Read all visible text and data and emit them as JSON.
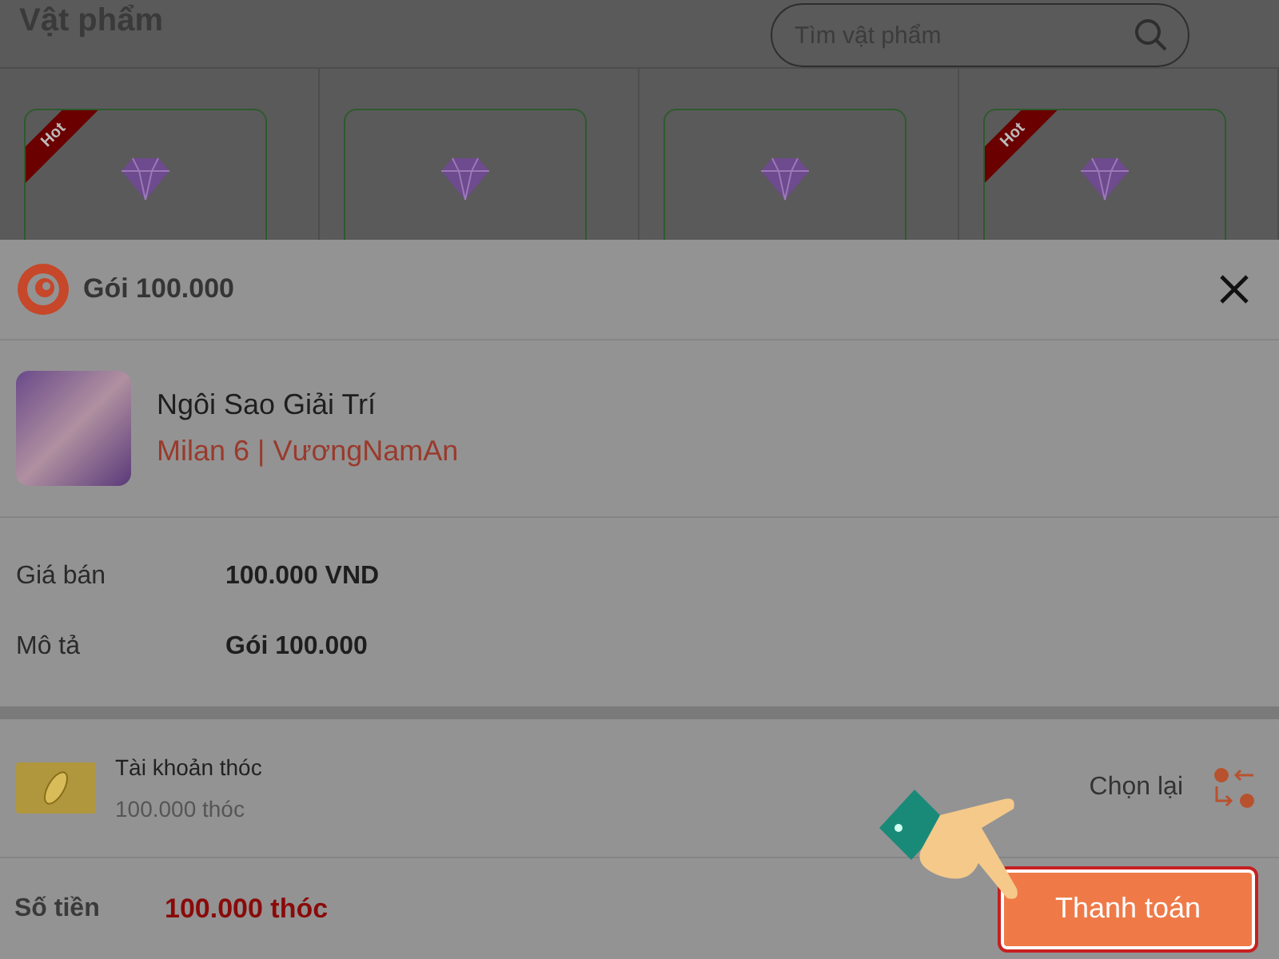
{
  "page": {
    "title": "Vật phẩm",
    "search": {
      "placeholder": "Tìm vật phẩm"
    },
    "items": [
      {
        "kind": "hot",
        "badge": "Hot"
      },
      {
        "kind": "plain"
      },
      {
        "kind": "plain"
      },
      {
        "kind": "hot",
        "badge": "Hot"
      }
    ]
  },
  "sheet": {
    "title": "Gói 100.000",
    "game": {
      "name": "Ngôi Sao Giải Trí",
      "server": "Milan 6 | VươngNamAn"
    },
    "details": [
      {
        "label": "Giá bán",
        "value": "100.000 VND"
      },
      {
        "label": "Mô tả",
        "value": "Gói 100.000"
      }
    ],
    "account": {
      "name": "Tài khoản thóc",
      "balance": "100.000 thóc",
      "change": "Chọn lại"
    },
    "total": {
      "label": "Số tiền",
      "value": "100.000 thóc"
    },
    "pay_button": "Thanh toán"
  }
}
